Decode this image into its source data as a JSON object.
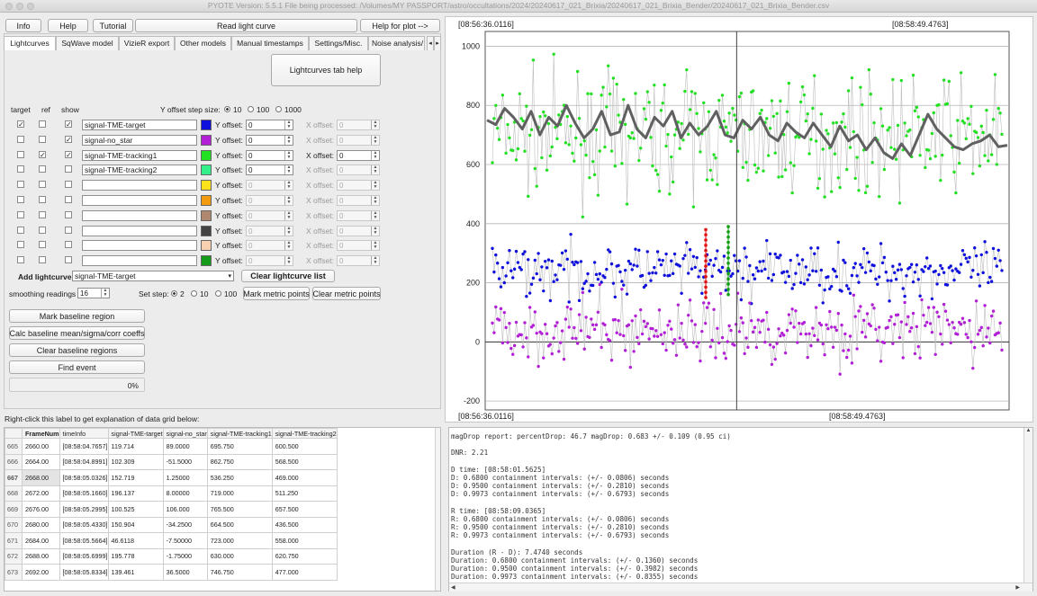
{
  "window": {
    "title": "PYOTE Version: 5.5.1  File being processed: /Volumes/MY PASSPORT/astro/occultations/2024/20240617_021_Brixia/20240617_021_Brixia_Bender/20240617_021_Brixia_Bender.csv"
  },
  "toolbar": {
    "info": "Info",
    "help": "Help",
    "tutorial": "Tutorial",
    "read": "Read light curve",
    "help_plot": "Help for plot -->"
  },
  "tabs": [
    "Lightcurves",
    "SqWave model",
    "VizieR export",
    "Other models",
    "Manual timestamps",
    "Settings/Misc.",
    "Noise analysis/"
  ],
  "tab_help": "Lightcurves tab help",
  "curve_headers": {
    "target": "target",
    "ref": "ref",
    "show": "show"
  },
  "offset_step": {
    "label": "Y offset step size:",
    "options": [
      "10",
      "100",
      "1000"
    ],
    "selected": "10"
  },
  "y_offset_label": "Y offset:",
  "x_offset_label": "X offset:",
  "curves": [
    {
      "name": "signal-TME-target",
      "color": "#1010dd",
      "target": true,
      "ref": false,
      "show": true,
      "y": "0",
      "x": "0",
      "x_enabled": false
    },
    {
      "name": "signal-no_star",
      "color": "#b21fd6",
      "target": false,
      "ref": false,
      "show": true,
      "y": "0",
      "x": "0",
      "x_enabled": false
    },
    {
      "name": "signal-TME-tracking1",
      "color": "#22e022",
      "target": false,
      "ref": true,
      "show": true,
      "y": "0",
      "x": "0",
      "x_enabled": true
    },
    {
      "name": "signal-TME-tracking2",
      "color": "#33f08a",
      "target": false,
      "ref": false,
      "show": false,
      "y": "0",
      "x": "0",
      "x_enabled": false
    },
    {
      "name": "",
      "color": "#ffe21a",
      "target": false,
      "ref": false,
      "show": false,
      "y": "0",
      "x": "0",
      "x_enabled": false
    },
    {
      "name": "",
      "color": "#f29a10",
      "target": false,
      "ref": false,
      "show": false,
      "y": "0",
      "x": "0",
      "x_enabled": false
    },
    {
      "name": "",
      "color": "#b08870",
      "target": false,
      "ref": false,
      "show": false,
      "y": "0",
      "x": "0",
      "x_enabled": false
    },
    {
      "name": "",
      "color": "#434343",
      "target": false,
      "ref": false,
      "show": false,
      "y": "0",
      "x": "0",
      "x_enabled": false
    },
    {
      "name": "",
      "color": "#f8d2b0",
      "target": false,
      "ref": false,
      "show": false,
      "y": "0",
      "x": "0",
      "x_enabled": false
    },
    {
      "name": "",
      "color": "#169a1a",
      "target": false,
      "ref": false,
      "show": false,
      "y": "0",
      "x": "0",
      "x_enabled": false
    }
  ],
  "add_curve": {
    "label": "Add lightcurve",
    "selected": "signal-TME-target",
    "clear": "Clear lightcurve list"
  },
  "smoothing": {
    "label": "smoothing readings",
    "value": "16"
  },
  "set_step": {
    "label": "Set step:",
    "options": [
      "2",
      "10",
      "100"
    ],
    "selected": "2"
  },
  "metric": {
    "mark": "Mark metric points",
    "clear": "Clear metric points"
  },
  "baseline": {
    "mark": "Mark baseline region",
    "calc": "Calc baseline mean/sigma/corr coeffs",
    "clear": "Clear baseline regions",
    "find": "Find event"
  },
  "progress": {
    "value": 0,
    "text": "0%"
  },
  "grid_hint": "Right-click this label to get explanation of data grid below:",
  "table": {
    "columns": [
      "FrameNum",
      "timeInfo",
      "signal-TME-target",
      "signal-no_star",
      "signal-TME-tracking1",
      "signal-TME-tracking2"
    ],
    "rows": [
      {
        "id": "665",
        "cells": [
          "2660.00",
          "[08:58:04.7657]",
          "119.714",
          "89.0000",
          "695.750",
          "600.500"
        ]
      },
      {
        "id": "666",
        "cells": [
          "2664.00",
          "[08:58:04.8991]",
          "102.309",
          "-51.5000",
          "862.750",
          "568.500"
        ]
      },
      {
        "id": "667",
        "cells": [
          "2668.00",
          "[08:58:05.0326]",
          "152.719",
          "1.25000",
          "536.250",
          "469.000"
        ]
      },
      {
        "id": "668",
        "cells": [
          "2672.00",
          "[08:58:05.1660]",
          "196.137",
          "8.00000",
          "719.000",
          "511.250"
        ]
      },
      {
        "id": "669",
        "cells": [
          "2676.00",
          "[08:58:05.2995]",
          "100.525",
          "106.000",
          "765.500",
          "657.500"
        ]
      },
      {
        "id": "670",
        "cells": [
          "2680.00",
          "[08:58:05.4330]",
          "150.904",
          "-34.2500",
          "664.500",
          "436.500"
        ]
      },
      {
        "id": "671",
        "cells": [
          "2684.00",
          "[08:58:05.5664]",
          "46.6118",
          "-7.50000",
          "723.000",
          "558.000"
        ]
      },
      {
        "id": "672",
        "cells": [
          "2688.00",
          "[08:58:05.6999]",
          "195.778",
          "-1.75000",
          "630.000",
          "620.750"
        ]
      },
      {
        "id": "673",
        "cells": [
          "2692.00",
          "[08:58:05.8334]",
          "139.461",
          "36.5000",
          "746.750",
          "477.000"
        ]
      }
    ]
  },
  "report_lines": [
    "magDrop report: percentDrop: 46.7 magDrop: 0.683 +/- 0.109 (0.95 ci)",
    "",
    "DNR: 2.21",
    "",
    "D time: [08:58:01.5625]",
    "D: 0.6800 containment intervals: (+/- 0.0806) seconds",
    "D: 0.9500 containment intervals: (+/- 0.2810) seconds",
    "D: 0.9973 containment intervals: (+/- 0.6793) seconds",
    "",
    "R time: [08:58:09.0365]",
    "R: 0.6800 containment intervals: (+/- 0.0806) seconds",
    "R: 0.9500 containment intervals: (+/- 0.2810) seconds",
    "R: 0.9973 containment intervals: (+/- 0.6793) seconds",
    "",
    "Duration (R - D): 7.4740 seconds",
    "Duration: 0.6800 containment intervals: (+/- 0.1360) seconds",
    "Duration: 0.9500 containment intervals: (+/- 0.3982) seconds",
    "Duration: 0.9973 containment intervals: (+/- 0.8355) seconds"
  ],
  "chart_data": {
    "type": "scatter",
    "time_labels": {
      "top_left": "[08:56:36.0116]",
      "top_right": "[08:58:49.4763]",
      "bottom_left": "[08:56:36.0116]",
      "bottom_right": "[08:58:49.4763]"
    },
    "ylim": [
      -230,
      1050
    ],
    "yticks": [
      -200,
      0,
      200,
      400,
      600,
      800,
      1000
    ],
    "grid": true,
    "cursor_x": 0.48,
    "series": [
      {
        "name": "signal-TME-tracking1",
        "color": "#22e022",
        "mean": 700,
        "spread": 95
      },
      {
        "name": "signal-TME-target",
        "color": "#1010dd",
        "mean": 240,
        "spread": 45
      },
      {
        "name": "signal-no_star",
        "color": "#b21fd6",
        "mean": 40,
        "spread": 55
      }
    ],
    "smoothed": {
      "color": "#606060",
      "values": [
        750,
        735,
        790,
        760,
        720,
        780,
        700,
        760,
        730,
        800,
        740,
        690,
        720,
        780,
        700,
        710,
        800,
        720,
        690,
        760,
        730,
        780,
        690,
        740,
        700,
        730,
        780,
        700,
        690,
        750,
        720,
        760,
        700,
        680,
        740,
        710,
        690,
        740,
        700,
        660,
        730,
        680,
        700,
        650,
        690,
        640,
        620,
        670,
        630,
        700,
        770,
        720,
        690,
        660,
        650,
        670,
        680,
        700,
        660,
        665
      ]
    },
    "markers": [
      {
        "color": "#e01010",
        "x_frac": 0.421,
        "y_from": 150,
        "y_to": 380
      },
      {
        "color": "#10a010",
        "x_frac": 0.464,
        "y_from": 160,
        "y_to": 390
      }
    ]
  }
}
